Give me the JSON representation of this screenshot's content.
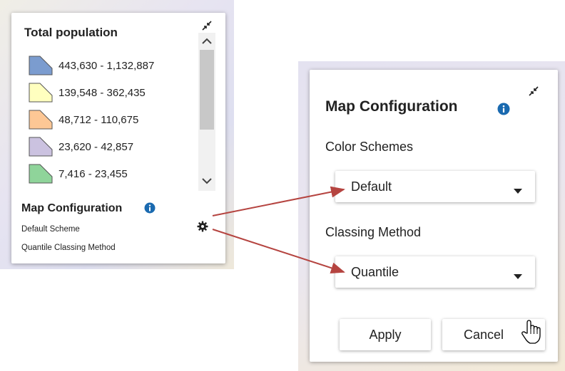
{
  "legend": {
    "title": "Total population",
    "items": [
      {
        "label": "443,630 - 1,132,887",
        "color": "#7b9ccf"
      },
      {
        "label": "139,548 - 362,435",
        "color": "#ffffbf"
      },
      {
        "label": "48,712 - 110,675",
        "color": "#fdc795"
      },
      {
        "label": "23,620 - 42,857",
        "color": "#cbc2e0"
      },
      {
        "label": "7,416 - 23,455",
        "color": "#8fd49a"
      }
    ],
    "config_title": "Map Configuration",
    "scheme_text": "Default Scheme",
    "method_text": "Quantile Classing Method"
  },
  "config_panel": {
    "title": "Map Configuration",
    "color_schemes_label": "Color Schemes",
    "color_scheme_value": "Default",
    "classing_method_label": "Classing Method",
    "classing_method_value": "Quantile",
    "apply_label": "Apply",
    "cancel_label": "Cancel"
  },
  "colors": {
    "info": "#1a6ab0",
    "arrow": "#b54440"
  }
}
